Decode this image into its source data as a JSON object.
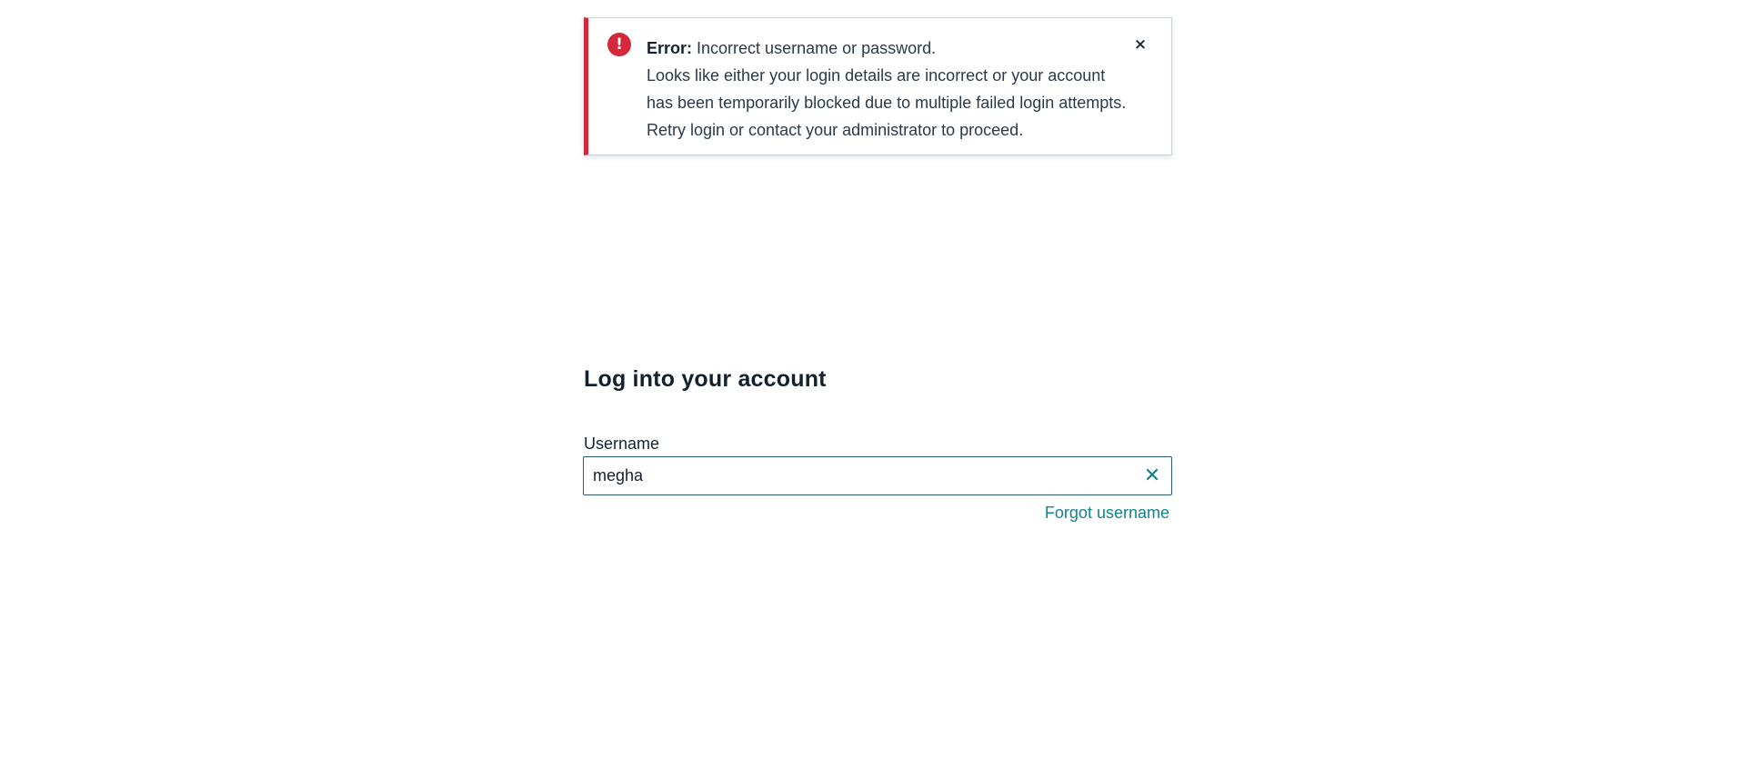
{
  "alert": {
    "icon": "exclamation-circle-icon",
    "icon_glyph": "!",
    "title": "Error:",
    "message": "Incorrect username or password.",
    "detail": "Looks like either your login details are incorrect or your account has been temporarily blocked due to multiple failed login attempts.",
    "action": "Retry login or contact your administrator to proceed.",
    "close_glyph": "×",
    "close_icon": "close-icon",
    "accent_color": "#d4293a"
  },
  "login": {
    "title": "Log into your account",
    "username_label": "Username",
    "username_value": "megha",
    "clear_glyph": "✕",
    "clear_icon": "clear-icon",
    "forgot_username": "Forgot username",
    "link_color": "#13838d"
  }
}
